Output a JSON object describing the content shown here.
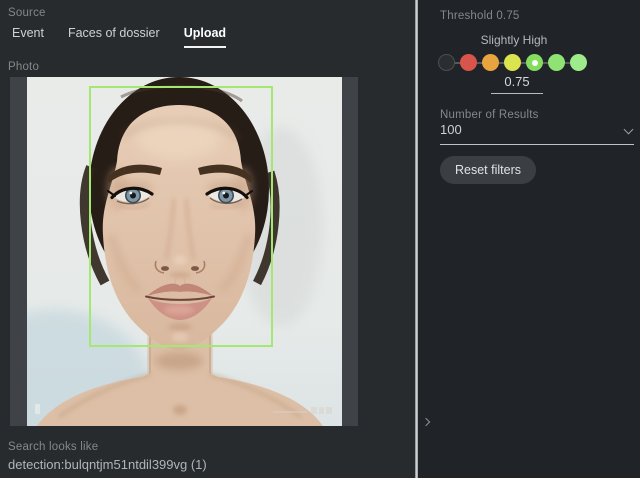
{
  "source": {
    "label": "Source",
    "tabs": [
      {
        "label": "Event",
        "active": false
      },
      {
        "label": "Faces of dossier",
        "active": false
      },
      {
        "label": "Upload",
        "active": true
      }
    ]
  },
  "photo": {
    "label": "Photo",
    "description": "studio portrait of a woman with dark pulled-back hair, detected face outlined",
    "detection_box_color": "#a3e873"
  },
  "filters": {
    "threshold": {
      "label": "Threshold 0.75",
      "level": "Slightly High",
      "value": "0.75",
      "dots": [
        {
          "color": "#2b2e31",
          "empty": true
        },
        {
          "color": "#d9544a"
        },
        {
          "color": "#e8a43f"
        },
        {
          "color": "#d9e44f"
        },
        {
          "color": "#84dd5e",
          "selected": true
        },
        {
          "color": "#8fe372"
        },
        {
          "color": "#9deb8b"
        }
      ]
    },
    "number_of_results": {
      "label": "Number of Results",
      "value": "100"
    },
    "reset_button_label": "Reset filters"
  },
  "search": {
    "looks_like_label": "Search looks like",
    "detection_id": "detection:bulqntjm51ntdil399vg (1)"
  },
  "icons": {
    "results_dropdown": "chevron-down",
    "panel_collapse": "chevron-right"
  }
}
